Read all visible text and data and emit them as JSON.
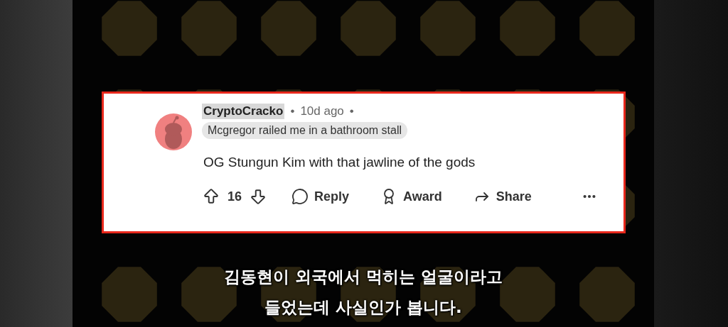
{
  "comment": {
    "author": "CryptoCracko",
    "author_highlighted": true,
    "separator_1": "•",
    "age": "10d ago",
    "separator_2": "•",
    "flair": "Mcgregor railed me in a bathroom stall",
    "body": "OG Stungun Kim with that jawline of the gods",
    "score": "16",
    "actions": [
      {
        "kind": "reply",
        "label": "Reply"
      },
      {
        "kind": "award",
        "label": "Award"
      },
      {
        "kind": "share",
        "label": "Share"
      }
    ]
  },
  "subtitles": [
    "김동현이 외국에서 먹히는 얼굴이라고",
    "들었는데 사실인가 봅니다."
  ]
}
